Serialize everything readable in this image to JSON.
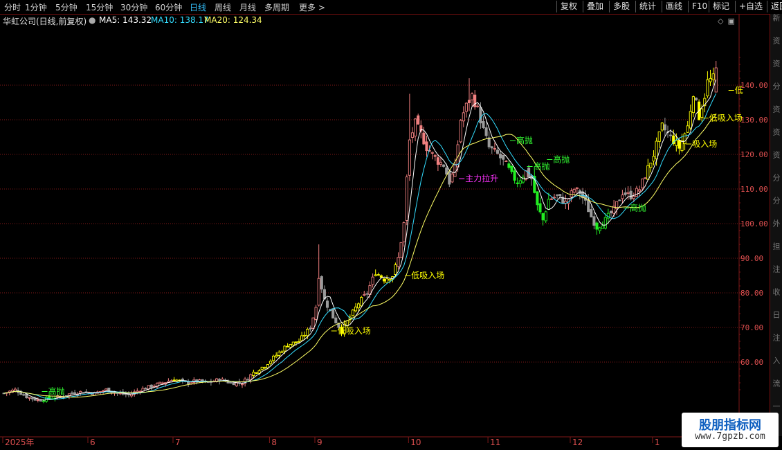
{
  "periods": [
    "分时",
    "1分钟",
    "5分钟",
    "15分钟",
    "30分钟",
    "60分钟",
    "日线",
    "周线",
    "月线",
    "多周期",
    "更多 >"
  ],
  "active_period": "日线",
  "tools": [
    "复权",
    "叠加",
    "多股",
    "统计",
    "画线",
    "F10",
    "标记",
    "+自选",
    "返回"
  ],
  "info": {
    "title": "华虹公司(日线,前复权)",
    "ma5_label": "MA5: 143.32",
    "ma10_label": "MA10: 138.17",
    "ma20_label": "MA20: 124.34"
  },
  "colors": {
    "up": "#f08080",
    "down": "#9a9a9a",
    "yellow": "#ffff00",
    "green": "#22ee22",
    "ma5": "#ffffff",
    "ma10": "#33ddff",
    "ma20": "#ffff66",
    "grid": "#801818",
    "label_yellow": "#ffff00",
    "label_green": "#33ff33",
    "label_magenta": "#ff33ff"
  },
  "right_panel_chars": [
    "新",
    "资",
    "资",
    "分",
    "资",
    "资",
    "资",
    "分",
    "分",
    "外",
    "担",
    "注",
    "收",
    "日",
    "注",
    "入",
    "流",
    "一"
  ],
  "watermark": {
    "line1": "股朋指标网",
    "line2": "www.7gpzb.com"
  },
  "chart_data": {
    "type": "candlestick",
    "yaxis": {
      "ylim": [
        50,
        150
      ],
      "ticks": [
        60,
        70,
        80,
        90,
        100,
        110,
        120,
        130,
        140
      ],
      "tick_labels": [
        "60.00",
        "70.00",
        "80.00",
        "90.00",
        "100.00",
        "110.00",
        "120.00",
        "130.00",
        "140.00"
      ]
    },
    "xaxis_labels": [
      {
        "label": "2025年",
        "month_index": 0
      },
      {
        "label": "6",
        "month_index": 1
      },
      {
        "label": "7",
        "month_index": 2
      },
      {
        "label": "8",
        "month_index": 3
      },
      {
        "label": "9",
        "month_index": 4
      },
      {
        "label": "10",
        "month_index": 5
      },
      {
        "label": "11",
        "month_index": 6
      },
      {
        "label": "12",
        "month_index": 7
      },
      {
        "label": "1",
        "month_index": 8
      }
    ],
    "month_start_bar": [
      0,
      30,
      60,
      94,
      110,
      143,
      171,
      200,
      229
    ],
    "anchors": [
      [
        0,
        51
      ],
      [
        4,
        52
      ],
      [
        8,
        50
      ],
      [
        12,
        49
      ],
      [
        16,
        49.5
      ],
      [
        20,
        50
      ],
      [
        24,
        51
      ],
      [
        28,
        51.5
      ],
      [
        32,
        51
      ],
      [
        36,
        52
      ],
      [
        40,
        51
      ],
      [
        44,
        50.5
      ],
      [
        48,
        52
      ],
      [
        52,
        53
      ],
      [
        56,
        54
      ],
      [
        60,
        55
      ],
      [
        64,
        54
      ],
      [
        68,
        54.5
      ],
      [
        72,
        54
      ],
      [
        76,
        55
      ],
      [
        80,
        54
      ],
      [
        84,
        54
      ],
      [
        88,
        57
      ],
      [
        92,
        59
      ],
      [
        96,
        62
      ],
      [
        100,
        65
      ],
      [
        104,
        66
      ],
      [
        108,
        70
      ],
      [
        110,
        76
      ],
      [
        111,
        85
      ],
      [
        113,
        78
      ],
      [
        116,
        73
      ],
      [
        119,
        69
      ],
      [
        122,
        73
      ],
      [
        125,
        77
      ],
      [
        128,
        80
      ],
      [
        131,
        86
      ],
      [
        134,
        84
      ],
      [
        137,
        85
      ],
      [
        139,
        90
      ],
      [
        141,
        100
      ],
      [
        142,
        113
      ],
      [
        143,
        124
      ],
      [
        145,
        129
      ],
      [
        147,
        126
      ],
      [
        149,
        122
      ],
      [
        151,
        120
      ],
      [
        153,
        118
      ],
      [
        155,
        117
      ],
      [
        157,
        112
      ],
      [
        159,
        116
      ],
      [
        161,
        130
      ],
      [
        163,
        134
      ],
      [
        165,
        137
      ],
      [
        167,
        133
      ],
      [
        169,
        127
      ],
      [
        171,
        122
      ],
      [
        174,
        120
      ],
      [
        177,
        117
      ],
      [
        179,
        114
      ],
      [
        181,
        112
      ],
      [
        184,
        115
      ],
      [
        186,
        113
      ],
      [
        188,
        105
      ],
      [
        190,
        101
      ],
      [
        192,
        107
      ],
      [
        195,
        108
      ],
      [
        198,
        106
      ],
      [
        201,
        110
      ],
      [
        203,
        109
      ],
      [
        205,
        106
      ],
      [
        207,
        102
      ],
      [
        209,
        99
      ],
      [
        212,
        101
      ],
      [
        215,
        104
      ],
      [
        218,
        109
      ],
      [
        221,
        108
      ],
      [
        224,
        110
      ],
      [
        227,
        116
      ],
      [
        229,
        120
      ],
      [
        232,
        128
      ],
      [
        235,
        125
      ],
      [
        238,
        122
      ],
      [
        241,
        128
      ],
      [
        243,
        138
      ],
      [
        245,
        131
      ],
      [
        247,
        137
      ],
      [
        248,
        141
      ],
      [
        250,
        142
      ],
      [
        251,
        145
      ]
    ],
    "highlight_ranges": [
      {
        "from": 14,
        "to": 18,
        "color": "green"
      },
      {
        "from": 60,
        "to": 62,
        "color": "yellow"
      },
      {
        "from": 88,
        "to": 107,
        "color": "yellow"
      },
      {
        "from": 119,
        "to": 126,
        "color": "yellow"
      },
      {
        "from": 131,
        "to": 138,
        "color": "yellow"
      },
      {
        "from": 142,
        "to": 154,
        "color": "up"
      },
      {
        "from": 160,
        "to": 167,
        "color": "up"
      },
      {
        "from": 178,
        "to": 183,
        "color": "green"
      },
      {
        "from": 187,
        "to": 192,
        "color": "green"
      },
      {
        "from": 209,
        "to": 213,
        "color": "green"
      },
      {
        "from": 227,
        "to": 232,
        "color": "yellow"
      },
      {
        "from": 236,
        "to": 243,
        "color": "yellow"
      },
      {
        "from": 245,
        "to": 250,
        "color": "yellow"
      },
      {
        "from": 251,
        "to": 251,
        "color": "up"
      }
    ],
    "annotations": [
      {
        "text": "高抛",
        "bar": 13,
        "price": 51.5,
        "color": "label_green"
      },
      {
        "text": "低吸入场",
        "bar": 115,
        "price": 69,
        "color": "label_yellow"
      },
      {
        "text": "低吸入场",
        "bar": 141,
        "price": 85,
        "color": "label_yellow"
      },
      {
        "text": "主力拉升",
        "bar": 160,
        "price": 113,
        "color": "label_magenta"
      },
      {
        "text": "高抛",
        "bar": 178,
        "price": 124,
        "color": "label_green"
      },
      {
        "text": "高抛",
        "bar": 191,
        "price": 118.5,
        "color": "label_green"
      },
      {
        "text": "高抛",
        "bar": 184,
        "price": 116.5,
        "color": "label_green"
      },
      {
        "text": "高抛",
        "bar": 218,
        "price": 104.5,
        "color": "label_green"
      },
      {
        "text": "吸入场",
        "bar": 240,
        "price": 123,
        "color": "label_yellow"
      },
      {
        "text": "低吸入场",
        "bar": 246,
        "price": 130.5,
        "color": "label_yellow"
      },
      {
        "text": "低",
        "bar": 255,
        "price": 138.5,
        "color": "label_yellow"
      }
    ]
  }
}
